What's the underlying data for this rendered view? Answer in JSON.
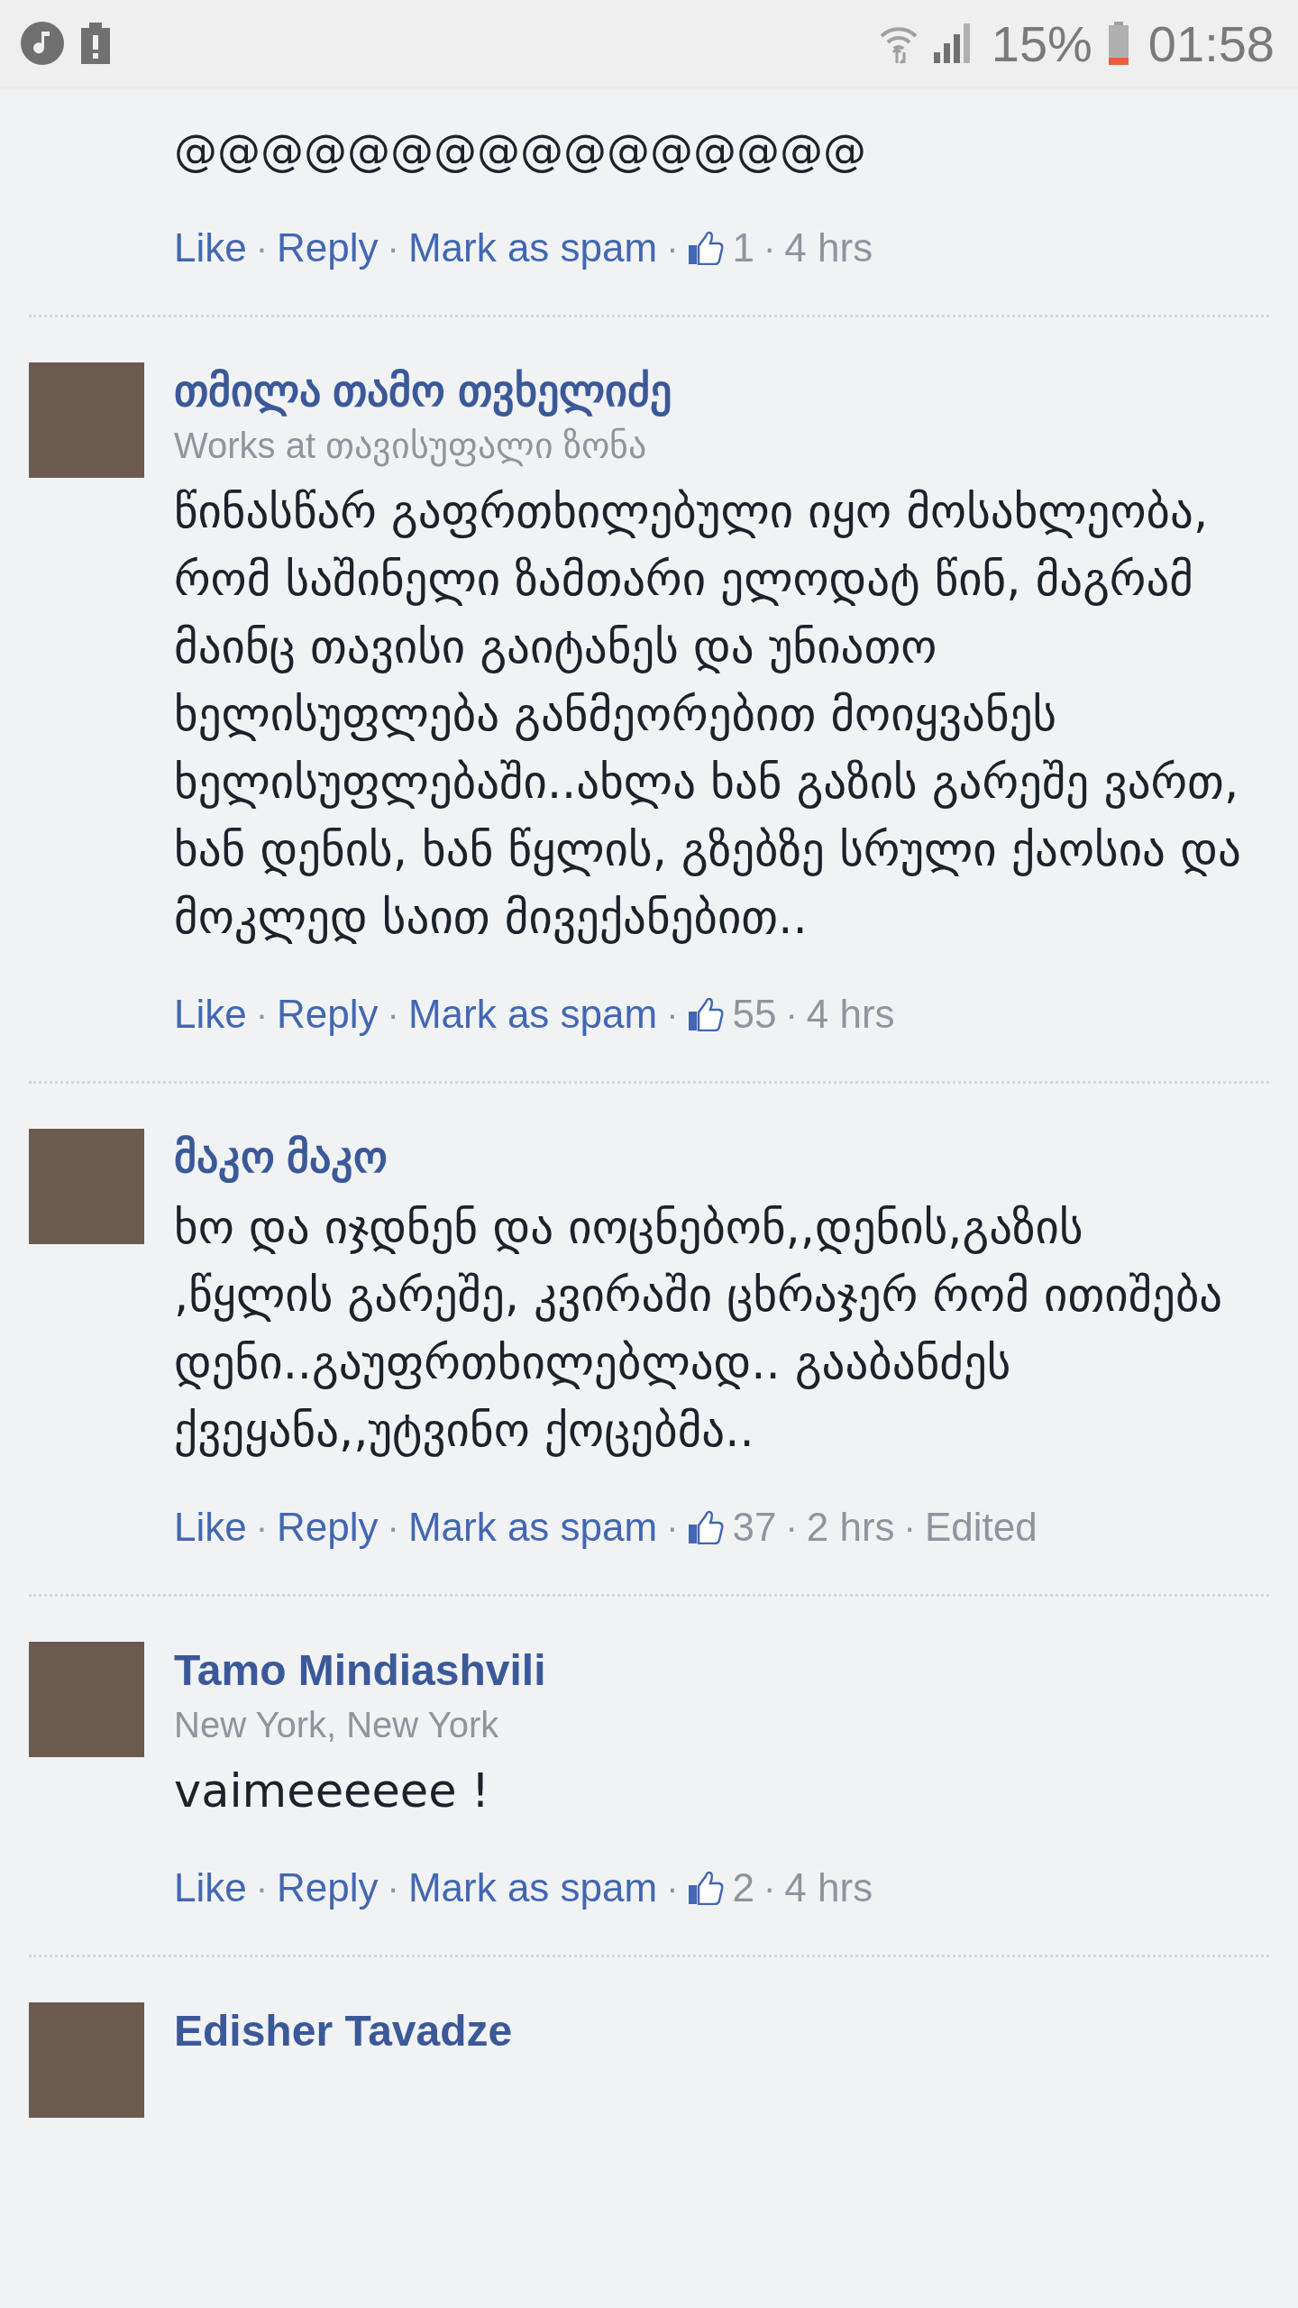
{
  "status_bar": {
    "battery_text": "15%",
    "time": "01:58"
  },
  "comments": [
    {
      "body": "@@@@@@@@@@@@@@@@",
      "actions": {
        "like": "Like",
        "reply": "Reply",
        "spam": "Mark as spam",
        "likes": "1",
        "time": "4 hrs",
        "separator": "·"
      }
    },
    {
      "author": "თმილა თამო თვხელიძე",
      "subtitle": "Works at თავისუფალი ზონა",
      "body": "წინასწარ გაფრთხილებული იყო მოსახლეობა, რომ საშინელი ზამთარი ელოდატ წინ, მაგრამ მაინც თავისი გაიტანეს და უნიათო ხელისუფლება განმეორებით მოიყვანეს ხელისუფლებაში..ახლა ხან გაზის გარეშე ვართ, ხან დენის, ხან წყლის, გზებზე სრული ქაოსია და მოკლედ საით მივექანებით..",
      "actions": {
        "like": "Like",
        "reply": "Reply",
        "spam": "Mark as spam",
        "likes": "55",
        "time": "4 hrs",
        "separator": "·"
      }
    },
    {
      "author": "მაკო მაკო",
      "body": "ხო და იჯდნენ და იოცნებონ,,დენის,გაზის ,წყლის გარეშე, კვირაში ცხრაჯერ რომ ითიშება დენი..გაუფრთხილებლად.. გააბანძეს ქვეყანა,,უტვინო ქოცებმა..",
      "actions": {
        "like": "Like",
        "reply": "Reply",
        "spam": "Mark as spam",
        "likes": "37",
        "time": "2 hrs",
        "edited": "Edited",
        "separator": "·"
      }
    },
    {
      "author": "Tamo Mindiashvili",
      "subtitle": "New York, New York",
      "body": "vaimeeeeee !",
      "actions": {
        "like": "Like",
        "reply": "Reply",
        "spam": "Mark as spam",
        "likes": "2",
        "time": "4 hrs",
        "separator": "·"
      }
    },
    {
      "author": "Edisher Tavadze"
    }
  ]
}
